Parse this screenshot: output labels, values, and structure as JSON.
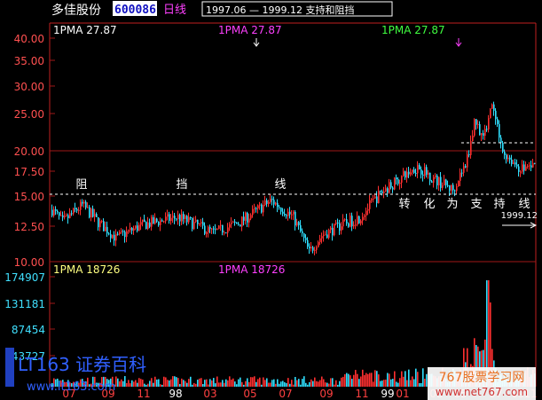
{
  "header": {
    "stock_name": "多佳股份",
    "stock_code": "600086",
    "period_label": "日线",
    "range_note": "1997.06 — 1999.12  支持和阻挡"
  },
  "price_panel": {
    "ma_labels": [
      {
        "text": "1PMA   27.87",
        "color": "#ffffff"
      },
      {
        "text": "1PMA   27.87",
        "color": "#ff40ff"
      },
      {
        "text": "1PMA   27.87",
        "color": "#40ff40"
      }
    ],
    "resistance_chars": [
      "阻",
      "挡",
      "线"
    ],
    "support_chars": [
      "转",
      "化",
      "为",
      "支",
      "持",
      "线"
    ],
    "end_label": "1999.12",
    "y_ticks": [
      "40.00",
      "35.00",
      "30.00",
      "25.00",
      "20.00",
      "17.50",
      "15.00",
      "12.50",
      "10.00"
    ]
  },
  "volume_panel": {
    "ma_labels": [
      {
        "text": "1PMA   18726",
        "color": "#ffff80"
      },
      {
        "text": "1PMA   18726",
        "color": "#ff40ff"
      }
    ],
    "y_ticks": [
      "174907",
      "131181",
      "87454",
      "43727"
    ]
  },
  "x_axis": {
    "labels": [
      {
        "text": "07",
        "color": "#ff4040"
      },
      {
        "text": "09",
        "color": "#ff4040"
      },
      {
        "text": "11",
        "color": "#ff4040"
      },
      {
        "text": "98",
        "color": "#ffffff"
      },
      {
        "text": "03",
        "color": "#ff4040"
      },
      {
        "text": "05",
        "color": "#ff4040"
      },
      {
        "text": "07",
        "color": "#ff4040"
      },
      {
        "text": "09",
        "color": "#ff4040"
      },
      {
        "text": "11",
        "color": "#ff4040"
      },
      {
        "text": "99",
        "color": "#ffffff"
      },
      {
        "text": "01",
        "color": "#ff4040"
      },
      {
        "text": "03",
        "color": "#ff4040"
      },
      {
        "text": "05",
        "color": "#ff4040"
      },
      {
        "text": "07",
        "color": "#ff4040"
      },
      {
        "text": "09",
        "color": "#ff4040"
      },
      {
        "text": "11",
        "color": "#ff4040"
      }
    ]
  },
  "watermarks": {
    "left_title": "LT163 证券百科",
    "left_url": "www.lt163.com",
    "right_title": "767股票学习网",
    "right_url": "www.net767.com"
  },
  "colors": {
    "axis": "#c02020",
    "grid": "#a01818",
    "up": "#ff3030",
    "down": "#30e0ff",
    "dash": "#ffffff",
    "tick_text": "#ff5050",
    "vol_text": "#40e0ff"
  }
}
